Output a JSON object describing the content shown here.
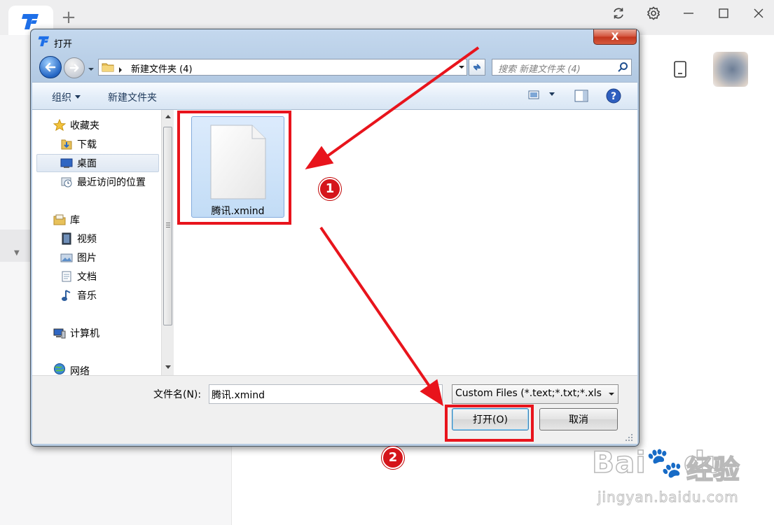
{
  "app": {
    "new_tab_glyph": "+"
  },
  "dialog": {
    "title": "打开",
    "close_glyph": "X",
    "address": {
      "path": "新建文件夹 (4)"
    },
    "search": {
      "placeholder": "搜索 新建文件夹 (4)"
    },
    "toolbar": {
      "organize_label": "组织",
      "new_folder_label": "新建文件夹"
    },
    "nav": {
      "items": [
        {
          "label": "收藏夹",
          "icon": "star-icon"
        },
        {
          "label": "下载",
          "icon": "downloads-folder-icon"
        },
        {
          "label": "桌面",
          "icon": "desktop-icon"
        },
        {
          "label": "最近访问的位置",
          "icon": "recent-places-icon"
        },
        {
          "label": "库",
          "icon": "libraries-icon"
        },
        {
          "label": "视频",
          "icon": "videos-icon"
        },
        {
          "label": "图片",
          "icon": "pictures-icon"
        },
        {
          "label": "文档",
          "icon": "documents-icon"
        },
        {
          "label": "音乐",
          "icon": "music-icon"
        },
        {
          "label": "计算机",
          "icon": "computer-icon"
        },
        {
          "label": "网络",
          "icon": "network-icon"
        }
      ],
      "selected": "桌面"
    },
    "files": [
      {
        "name": "腾讯.xmind",
        "icon": "blank-document-icon"
      }
    ],
    "filename_label": "文件名(N):",
    "filename_value": "腾讯.xmind",
    "filetype_value": "Custom Files (*.text;*.txt;*.xls",
    "open_label": "打开(O)",
    "cancel_label": "取消"
  },
  "annotations": {
    "step1": "1",
    "step2": "2",
    "color": "#e8141c"
  },
  "watermark": {
    "brand": "Bai",
    "brand2": "du",
    "brand_cn": "经验",
    "url": "jingyan.baidu.com"
  }
}
